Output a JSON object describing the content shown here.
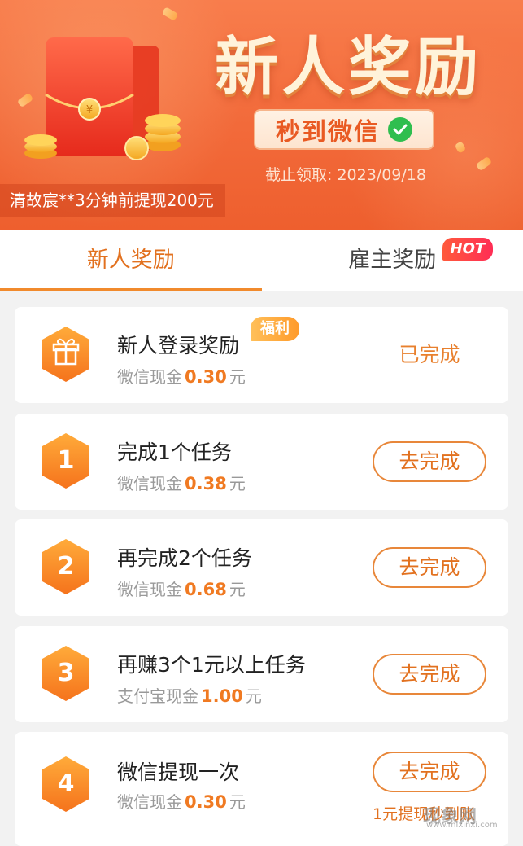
{
  "banner": {
    "title": "新人奖励",
    "wechat_pill": "秒到微信",
    "deadline": "截止领取: 2023/09/18",
    "ticker": "清故宸**3分钟前提现200元"
  },
  "tabs": [
    {
      "label": "新人奖励",
      "active": true
    },
    {
      "label": "雇主奖励",
      "active": false,
      "badge": "HOT"
    }
  ],
  "tasks": [
    {
      "icon": "gift-icon",
      "number": "",
      "title": "新人登录奖励",
      "badge": "福利",
      "sub_prefix": "微信现金",
      "amount": "0.30",
      "unit": "元",
      "action": "已完成",
      "status": "done"
    },
    {
      "number": "1",
      "title": "完成1个任务",
      "sub_prefix": "微信现金",
      "amount": "0.38",
      "unit": "元",
      "action": "去完成",
      "status": "todo"
    },
    {
      "number": "2",
      "title": "再完成2个任务",
      "sub_prefix": "微信现金",
      "amount": "0.68",
      "unit": "元",
      "action": "去完成",
      "status": "todo"
    },
    {
      "number": "3",
      "title": "再赚3个1元以上任务",
      "sub_prefix": "支付宝现金",
      "amount": "1.00",
      "unit": "元",
      "action": "去完成",
      "status": "todo"
    },
    {
      "number": "4",
      "title": "微信提现一次",
      "sub_prefix": "微信现金",
      "amount": "0.30",
      "unit": "元",
      "action": "去完成",
      "status": "todo",
      "note": "1元提现秒到账"
    }
  ],
  "watermark": {
    "text": "现象网",
    "url": "www.mixinxi.com"
  },
  "colors": {
    "accent": "#f18a2c",
    "banner": "#f26a3a",
    "wechat_green": "#2fbe4f",
    "hot": "#ff2d55"
  }
}
